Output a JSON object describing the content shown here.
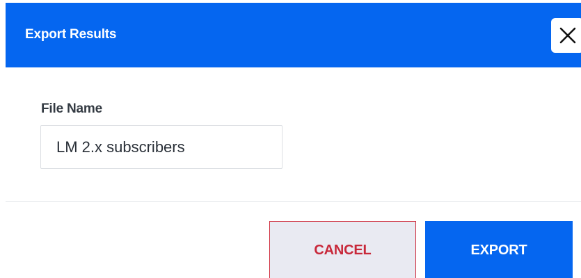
{
  "dialog": {
    "title": "Export Results",
    "close_icon": "close-icon",
    "accent_color": "#0566f0",
    "danger_color": "#c8283a"
  },
  "form": {
    "file_name_label": "File Name",
    "file_name_value": "LM 2.x subscribers"
  },
  "footer": {
    "cancel_label": "CANCEL",
    "export_label": "EXPORT"
  }
}
